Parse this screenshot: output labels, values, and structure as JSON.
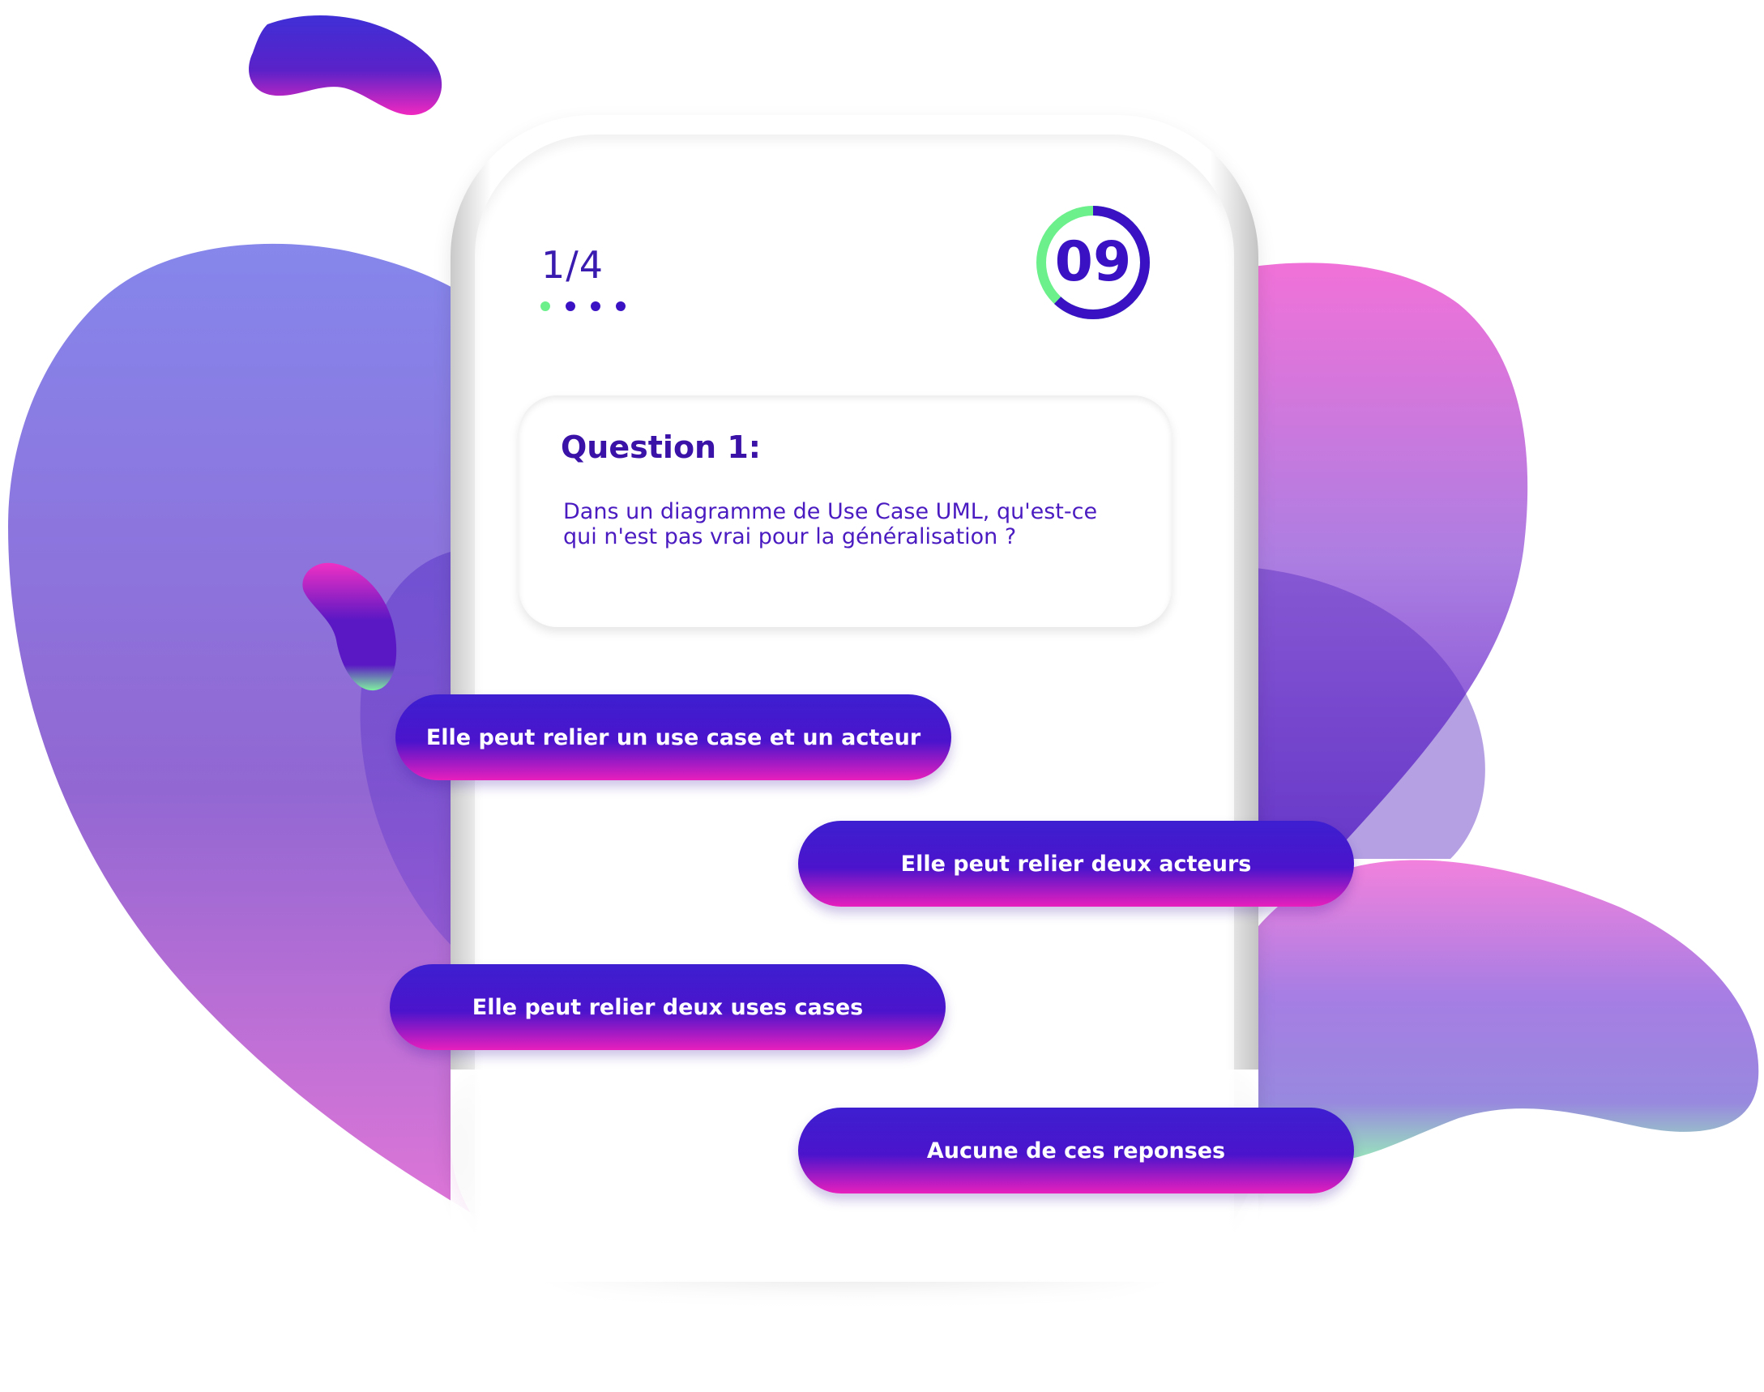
{
  "quiz": {
    "counter": "1/4",
    "dots": [
      {
        "active": true
      },
      {
        "active": false
      },
      {
        "active": false
      },
      {
        "active": false
      }
    ],
    "timer": {
      "value": "09",
      "progress": 0.62
    },
    "question": {
      "title": "Question 1:",
      "text": "Dans un diagramme de Use Case UML, qu'est-ce qui n'est pas vrai pour la généralisation ?"
    },
    "answers": [
      {
        "label": "Elle peut relier un use case et un acteur"
      },
      {
        "label": "Elle peut relier deux acteurs"
      },
      {
        "label": "Elle peut relier deux uses cases"
      },
      {
        "label": "Aucune de ces reponses"
      }
    ]
  },
  "colors": {
    "primary": "#3a12c4",
    "accent_green": "#6cf08c",
    "accent_pink": "#e81fbd",
    "blob_purple": "#7f72e6",
    "blob_pink": "#f06ad6"
  }
}
